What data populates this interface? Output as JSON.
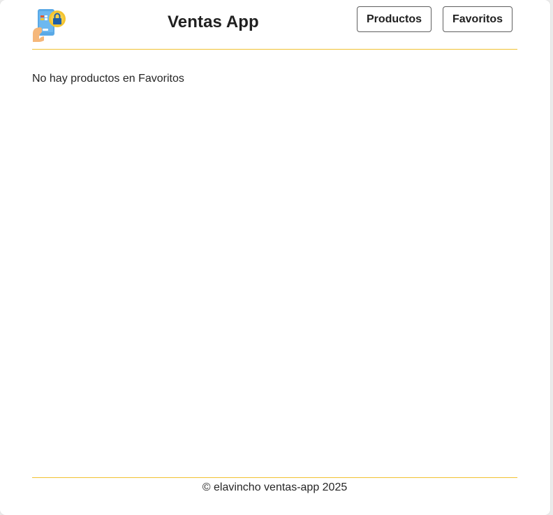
{
  "header": {
    "logo": "shopping-phone-logo",
    "title": "Ventas App",
    "nav": {
      "productos_label": "Productos",
      "favoritos_label": "Favoritos"
    }
  },
  "main": {
    "empty_message": "No hay productos en Favoritos"
  },
  "footer": {
    "copyright_symbol": "©",
    "text": "elavincho ventas-app 2025"
  },
  "colors": {
    "accent_line": "#f1c232",
    "background": "#ffffff",
    "button_border": "#5f5f5f"
  }
}
